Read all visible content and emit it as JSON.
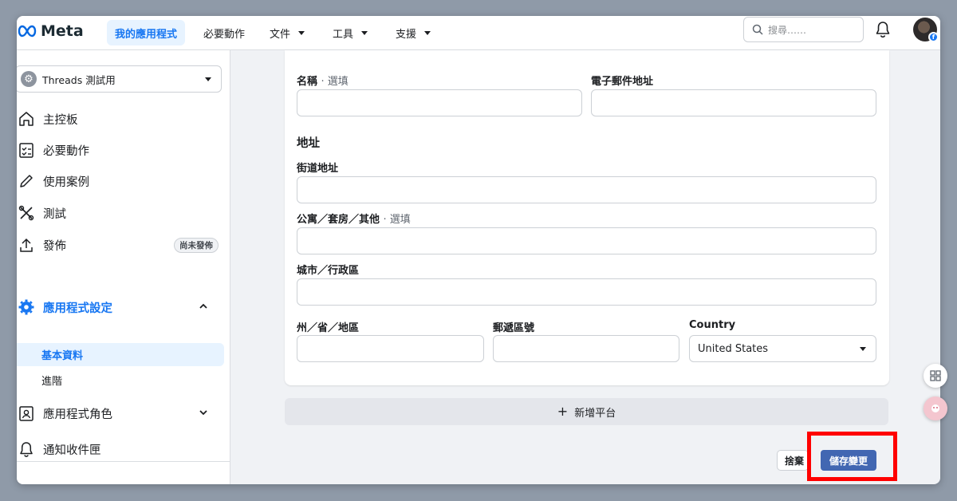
{
  "header": {
    "logo_text": "Meta",
    "nav": [
      {
        "label": "我的應用程式",
        "active": true
      },
      {
        "label": "必要動作"
      },
      {
        "label": "文件"
      },
      {
        "label": "工具"
      },
      {
        "label": "支援"
      }
    ],
    "search_placeholder": "搜尋……"
  },
  "sidebar": {
    "app_name": "Threads 測試用",
    "items": [
      {
        "label": "主控板",
        "icon": "home-icon"
      },
      {
        "label": "必要動作",
        "icon": "checklist-icon"
      },
      {
        "label": "使用案例",
        "icon": "pencil-icon"
      },
      {
        "label": "測試",
        "icon": "tools-icon"
      },
      {
        "label": "發佈",
        "icon": "upload-icon",
        "badge": "尚未發佈"
      }
    ],
    "settings_section": {
      "label": "應用程式設定",
      "icon": "gear-icon"
    },
    "settings_sub": [
      {
        "label": "基本資料",
        "active": true
      },
      {
        "label": "進階"
      }
    ],
    "roles_label": "應用程式角色",
    "notifications_label": "通知收件匣"
  },
  "form": {
    "name_label": "名稱",
    "name_opt": "· 選填",
    "email_label": "電子郵件地址",
    "address_title": "地址",
    "street_label": "街道地址",
    "apt_label": "公寓／套房／其他",
    "apt_opt": "· 選填",
    "city_label": "城市／行政區",
    "state_label": "州／省／地區",
    "zip_label": "郵遞區號",
    "country_label": "Country",
    "country_value": "United States"
  },
  "actions": {
    "add_platform": "新增平台",
    "discard": "捨棄",
    "save": "儲存變更"
  },
  "colors": {
    "accent": "#1877f2",
    "save_button": "#4267b2",
    "highlight": "#ff0000"
  }
}
